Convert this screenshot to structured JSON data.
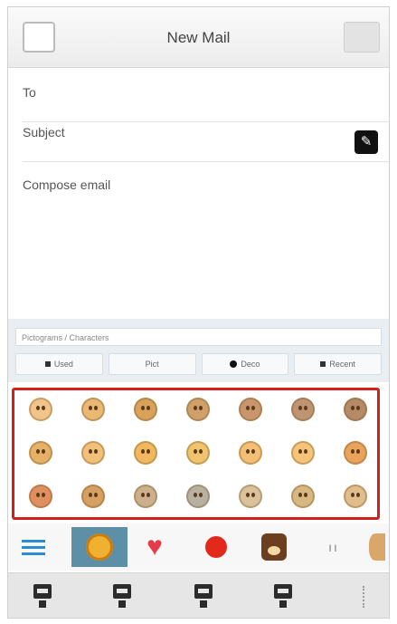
{
  "header": {
    "title": "New Mail",
    "send_label": ""
  },
  "fields": {
    "to_label": "To",
    "subject_label": "Subject",
    "compose_placeholder": "Compose email"
  },
  "emoji_panel": {
    "hint_text": "Pictograms / Characters",
    "hint_count": "",
    "tabs": [
      "Used",
      "Pict",
      "Deco",
      "Recent"
    ]
  },
  "emoji_grid": [
    [
      "#f2c48a",
      "#e8b874",
      "#d9a25a",
      "#cfa06a",
      "#c9956c",
      "#bf9472",
      "#b58a66"
    ],
    [
      "#e7b067",
      "#f1c07a",
      "#f2b860",
      "#f0c46e",
      "#f3bf75",
      "#f5c47a",
      "#e9a35c"
    ],
    [
      "#e08f5f",
      "#d6a062",
      "#ccb08c",
      "#b8b0a0",
      "#d9c29b",
      "#d8b882",
      "#e2bd8c"
    ]
  ],
  "categories": [
    "menu-icon",
    "smiley-icon",
    "heart-icon",
    "red-ball-icon",
    "bear-icon",
    "figures-icon",
    "more-icon"
  ],
  "bottom_keys": [
    "keyboard-icon",
    "keyboard-icon",
    "keyboard-icon",
    "keyboard-icon"
  ]
}
